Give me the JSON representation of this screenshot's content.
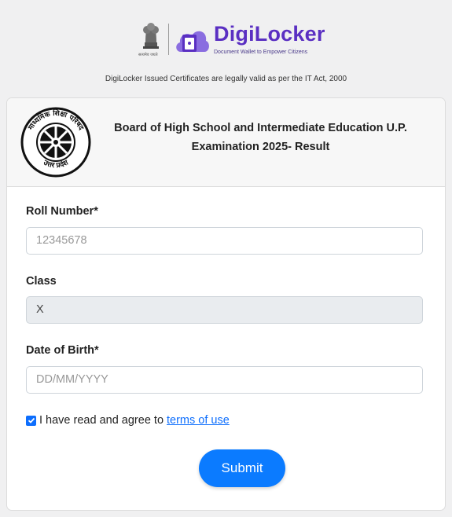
{
  "brand": {
    "emblem_caption": "सत्यमेव जयते",
    "name": "DigiLocker",
    "tagline": "Document Wallet to Empower Citizens"
  },
  "legal_note": "DigiLocker Issued Certificates are legally valid as per the IT Act, 2000",
  "board": {
    "logo_text_top": "माध्यमिक शिक्षा परिषद",
    "logo_text_bottom": "उत्तर प्रदेश",
    "title_line1": "Board of High School and Intermediate Education U.P.",
    "title_line2": "Examination 2025- Result"
  },
  "form": {
    "roll_label": "Roll Number*",
    "roll_placeholder": "12345678",
    "class_label": "Class",
    "class_value": "X",
    "dob_label": "Date of Birth*",
    "dob_placeholder": "DD/MM/YYYY",
    "agree_text": "I have read and agree to",
    "agree_link": "terms of use",
    "agree_checked": true,
    "submit_label": "Submit"
  },
  "colors": {
    "brand_purple": "#5a2fc2",
    "primary_blue": "#0b7bff"
  }
}
